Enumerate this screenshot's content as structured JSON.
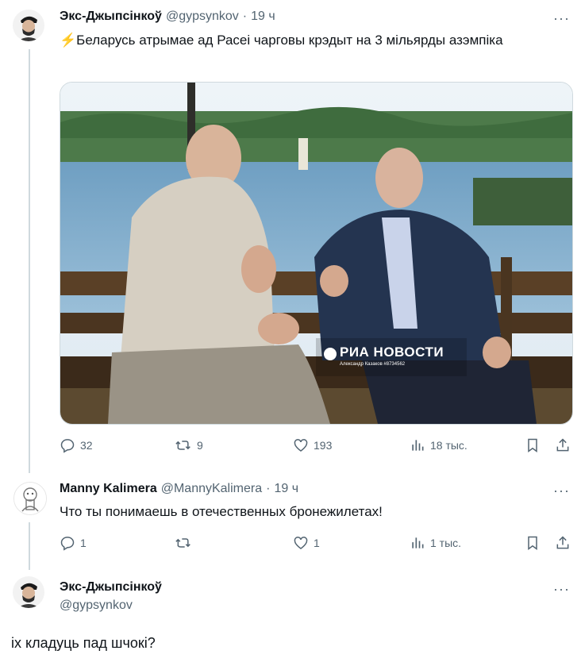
{
  "tweet1": {
    "name": "Экс-Джыпсінкоў",
    "handle": "@gypsynkov",
    "time": "19 ч",
    "emoji": "⚡",
    "text": "Беларусь атрымае ад Расеі чарговы крэдыт на 3 мільярды азэмпіка",
    "media": {
      "watermark_brand": "РИА НОВОСТИ",
      "watermark_credit": "Александр Казаков #8734562"
    },
    "stats": {
      "replies": "32",
      "retweets": "9",
      "likes": "193",
      "views": "18 тыс."
    }
  },
  "tweet2": {
    "name": "Manny Kalimera",
    "handle": "@MannyKalimera",
    "time": "19 ч",
    "text": "Что ты понимаешь в отечественных бронежилетах!",
    "stats": {
      "replies": "1",
      "retweets": "",
      "likes": "1",
      "views": "1 тыс."
    }
  },
  "tweet3": {
    "name": "Экс-Джыпсінкоў",
    "handle": "@gypsynkov",
    "text": "іх кладуць пад шчокі?"
  },
  "icons": {
    "more": "more-icon",
    "reply": "reply-icon",
    "retweet": "retweet-icon",
    "like": "like-icon",
    "views": "views-icon",
    "bookmark": "bookmark-icon",
    "share": "share-icon"
  },
  "colors": {
    "secondary_text": "#536471",
    "thread_line": "#cfd9de",
    "text": "#0f1419"
  },
  "more_label": "···"
}
